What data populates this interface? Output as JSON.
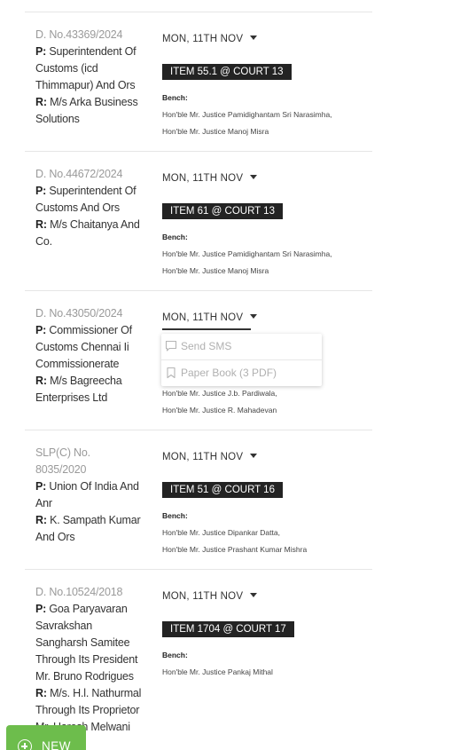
{
  "cases": [
    {
      "number": "D. No.43369/2024",
      "petitioner_prefix": "P:",
      "petitioner": "Superintendent Of Customs (icd Thimmapur) And Ors",
      "respondent_prefix": "R:",
      "respondent": "M/s Arka Business Solutions",
      "date": "MON, 11TH NOV",
      "item": "ITEM 55.1 @ COURT 13",
      "bench_label": "Bench:",
      "judges": [
        "Hon'ble Mr. Justice Pamidighantam Sri Narasimha,",
        "Hon'ble Mr. Justice Manoj Misra"
      ]
    },
    {
      "number": "D. No.44672/2024",
      "petitioner_prefix": "P:",
      "petitioner": "Superintendent Of Customs And Ors",
      "respondent_prefix": "R:",
      "respondent": "M/s Chaitanya And Co.",
      "date": "MON, 11TH NOV",
      "item": "ITEM 61 @ COURT 13",
      "bench_label": "Bench:",
      "judges": [
        "Hon'ble Mr. Justice Pamidighantam Sri Narasimha,",
        "Hon'ble Mr. Justice Manoj Misra"
      ]
    },
    {
      "number": "D. No.43050/2024",
      "petitioner_prefix": "P:",
      "petitioner": "Commissioner Of Customs Chennai Ii Commissionerate",
      "respondent_prefix": "R:",
      "respondent": "M/s Bagreecha Enterprises Ltd",
      "date": "MON, 11TH NOV",
      "judges": [
        "Hon'ble Mr. Justice J.b. Pardiwala,",
        "Hon'ble Mr. Justice R. Mahadevan"
      ]
    },
    {
      "number": "SLP(C) No. 8035/2020",
      "petitioner_prefix": "P:",
      "petitioner": "Union Of India And Anr",
      "respondent_prefix": "R:",
      "respondent": "K. Sampath Kumar And Ors",
      "date": "MON, 11TH NOV",
      "item": "ITEM 51 @ COURT 16",
      "bench_label": "Bench:",
      "judges": [
        "Hon'ble Mr. Justice Dipankar Datta,",
        "Hon'ble Mr. Justice Prashant Kumar Mishra"
      ]
    },
    {
      "number": "D. No.10524/2018",
      "petitioner_prefix": "P:",
      "petitioner": "Goa Paryavaran Savrakshan Sangharsh Samitee Through Its President Mr. Bruno Rodrigues",
      "respondent_prefix": "R:",
      "respondent": "M/s. H.l. Nathurmal Through Its Proprietor Mr. Haresh Melwani And Ors",
      "date": "MON, 11TH NOV",
      "item": "ITEM 1704 @ COURT 17",
      "bench_label": "Bench:",
      "judges": [
        "Hon'ble Mr. Justice Pankaj Mithal"
      ]
    }
  ],
  "popup": {
    "send_sms": "Send SMS",
    "paper_book": "Paper Book (3 PDF)",
    "send_sms_icon": "chat-bubble-icon",
    "paper_book_icon": "bookmark-icon"
  },
  "fab": {
    "label": "NEW",
    "icon": "plus-circle-icon",
    "color": "#6dbd4c"
  }
}
